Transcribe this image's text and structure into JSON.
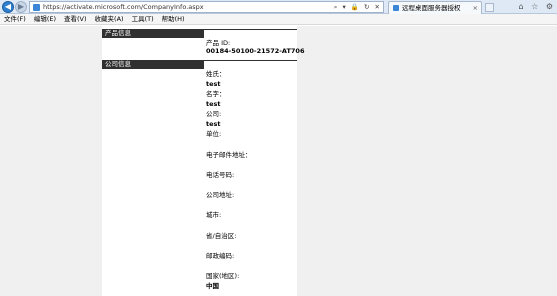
{
  "browser": {
    "url": "https://activate.microsoft.com/CompanyInfo.aspx",
    "tab_title": "远程桌面服务器授权",
    "tab_close": "×"
  },
  "menu": [
    "文件(F)",
    "编辑(E)",
    "查看(V)",
    "收藏夹(A)",
    "工具(T)",
    "帮助(H)"
  ],
  "sections": {
    "product": "产品信息",
    "company": "公司信息"
  },
  "product": {
    "id_label": "产品 ID:",
    "id_value": "00184-50100-21572-AT706"
  },
  "company": {
    "last_name_label": "姓氏：",
    "last_name_value": "test",
    "first_name_label": "名字：",
    "first_name_value": "test",
    "company_label": "公司:",
    "company_value": "test",
    "org_label": "单位:",
    "email_label": "电子邮件地址：",
    "phone_label": "电话号码:",
    "address_label": "公司地址:",
    "city_label": "城市:",
    "state_label": "省/自治区:",
    "zip_label": "邮政编码:",
    "country_label": "国家(地区):",
    "country_value": "中国"
  }
}
